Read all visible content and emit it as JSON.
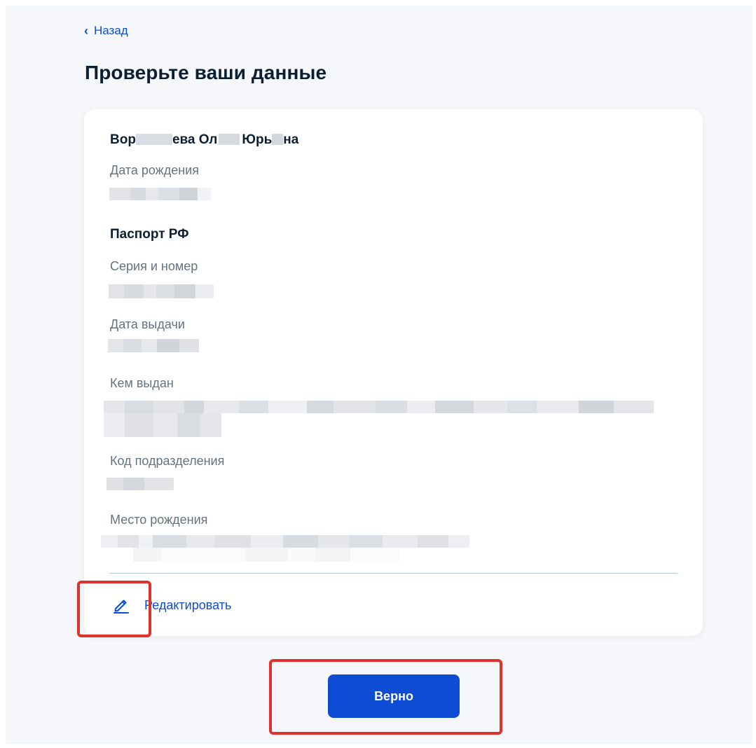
{
  "nav": {
    "back_label": "Назад"
  },
  "page": {
    "title": "Проверьте ваши данные"
  },
  "person": {
    "name_part_1": "Вор",
    "name_part_2": "ева Ол",
    "name_part_3": "Юрь",
    "name_part_4": "на",
    "birth_date_label": "Дата рождения"
  },
  "passport": {
    "section_title": "Паспорт РФ",
    "series_label": "Серия и номер",
    "issue_date_label": "Дата выдачи",
    "issued_by_label": "Кем выдан",
    "division_code_label": "Код подразделения",
    "birth_place_label": "Место рождения"
  },
  "actions": {
    "edit_label": "Редактировать",
    "confirm_label": "Верно"
  },
  "colors": {
    "accent": "#0d4cd3",
    "highlight": "#e0312d",
    "label": "#66727f"
  }
}
